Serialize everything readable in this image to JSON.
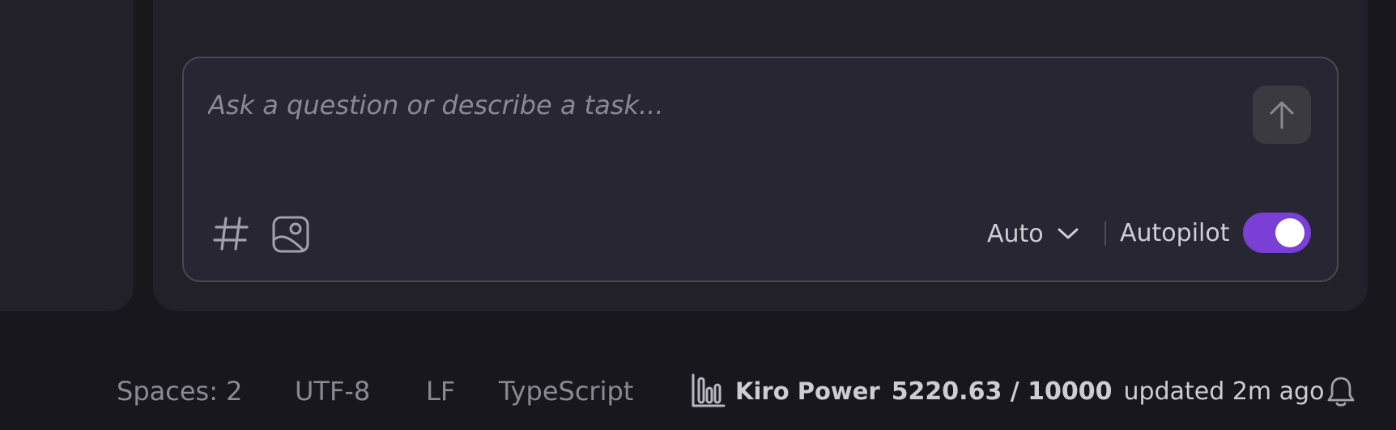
{
  "composer": {
    "placeholder": "Ask a question or describe a task...",
    "mode_value": "Auto",
    "autopilot_label": "Autopilot",
    "autopilot_enabled": true,
    "icons": {
      "send": "arrow-up-icon",
      "context": "hash-icon",
      "image": "image-icon",
      "mode_dropdown": "chevron-down-icon"
    }
  },
  "status_bar": {
    "spaces": "Spaces: 2",
    "encoding": "UTF-8",
    "line_ending": "LF",
    "language": "TypeScript",
    "power": {
      "icon": "usage-chart-icon",
      "name": "Kiro Power",
      "usage": "5220.63 / 10000",
      "updated": "updated 2m ago"
    },
    "notifications_icon": "bell-icon"
  },
  "colors": {
    "background": "#19171e",
    "panel": "#222028",
    "composer": "#282632",
    "accent": "#7a3fd6"
  }
}
